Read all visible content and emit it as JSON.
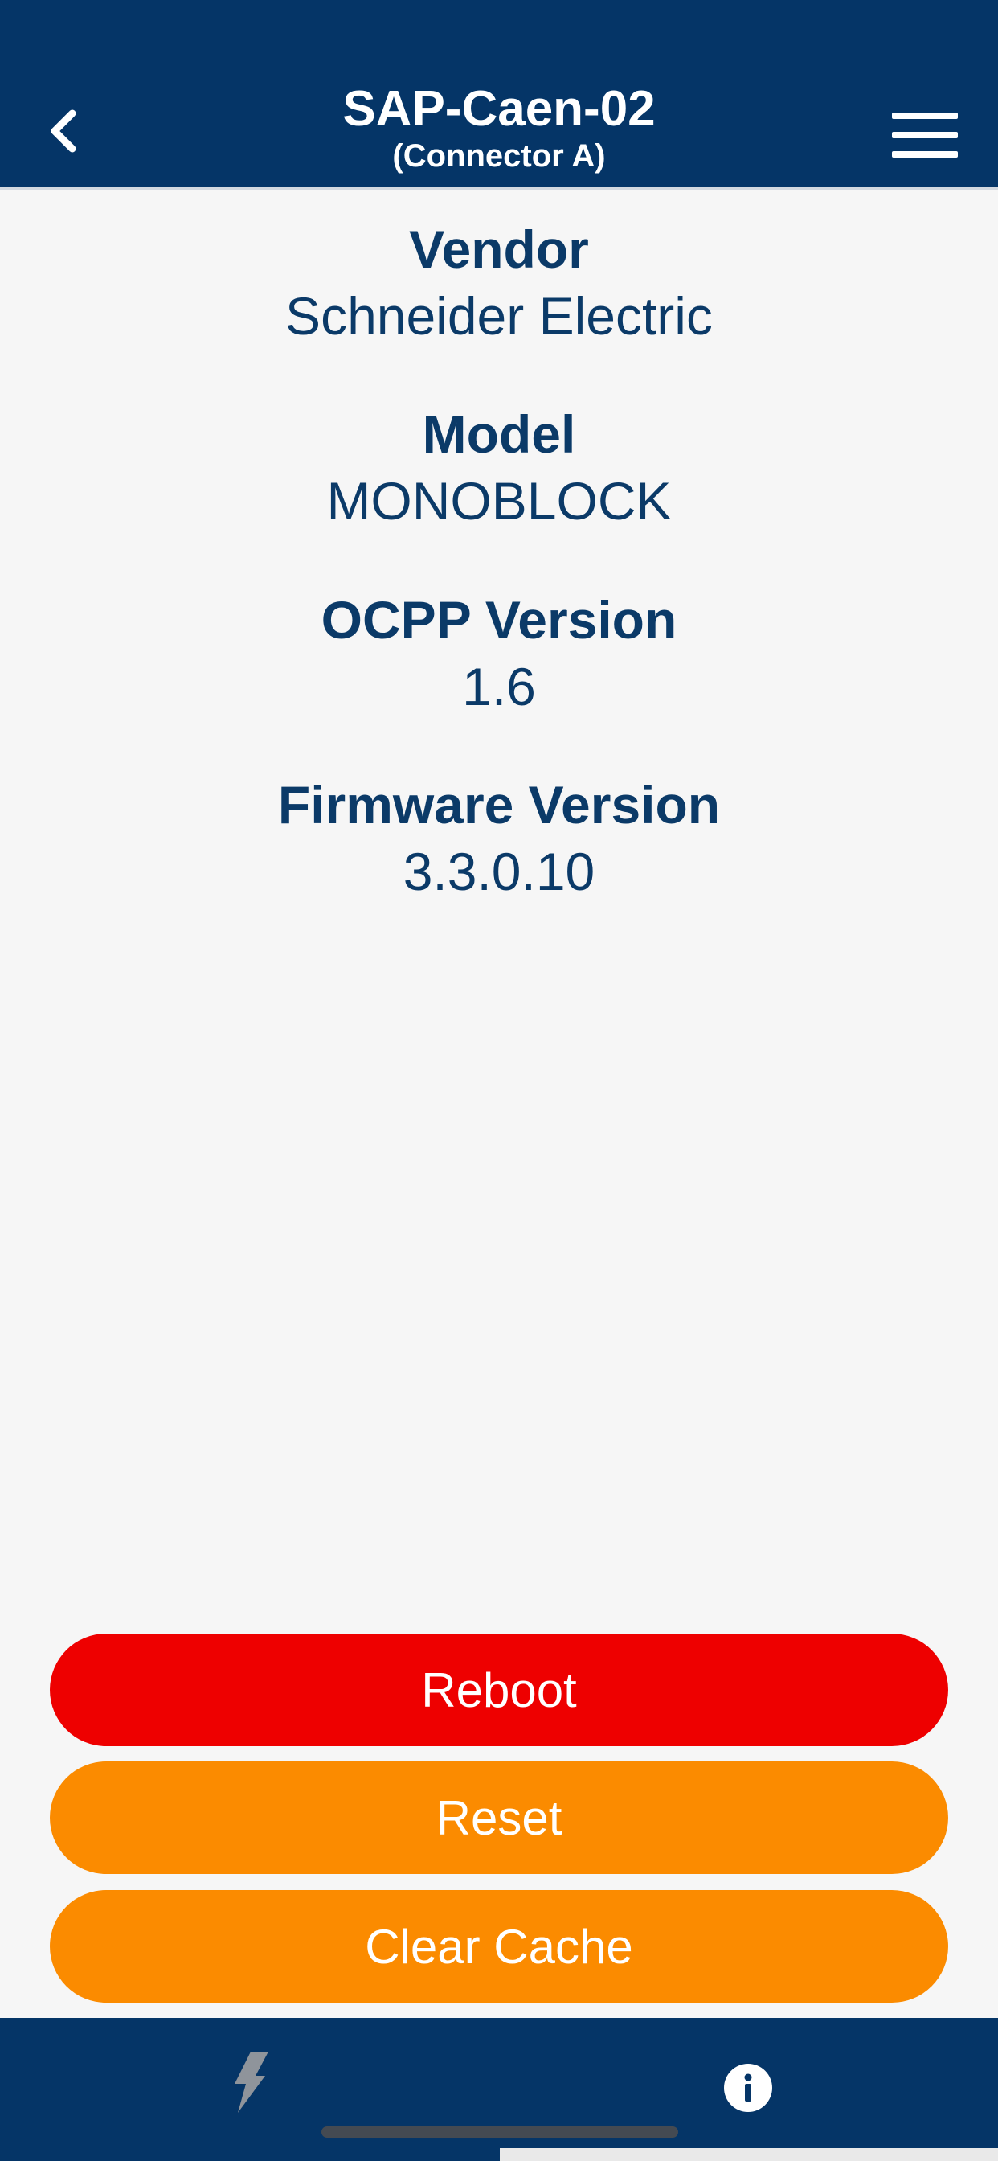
{
  "header": {
    "title": "SAP-Caen-02",
    "subtitle": "(Connector A)"
  },
  "details": {
    "vendor_label": "Vendor",
    "vendor_value": "Schneider Electric",
    "model_label": "Model",
    "model_value": "MONOBLOCK",
    "ocpp_label": "OCPP Version",
    "ocpp_value": "1.6",
    "firmware_label": "Firmware Version",
    "firmware_value": "3.3.0.10"
  },
  "actions": {
    "reboot": "Reboot",
    "reset": "Reset",
    "clear_cache": "Clear Cache"
  },
  "colors": {
    "brand_navy": "#053567",
    "text_navy": "#0b3a68",
    "danger_red": "#ee0000",
    "warning_orange": "#fb8b00"
  },
  "tabbar": {
    "tabs": [
      {
        "icon": "lightning-bolt-icon",
        "selected": false
      },
      {
        "icon": "info-circle-icon",
        "selected": true
      }
    ]
  }
}
